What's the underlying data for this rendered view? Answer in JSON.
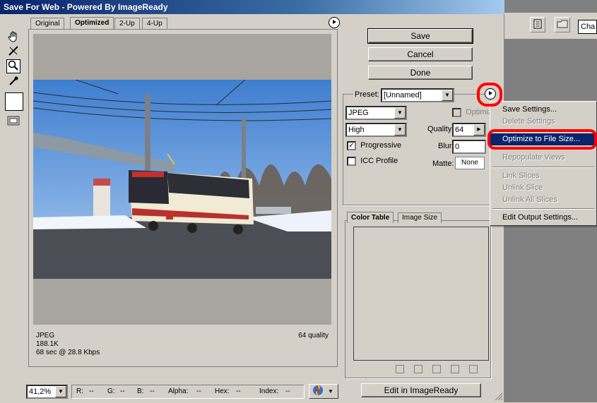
{
  "window": {
    "title": "Save For Web - Powered By ImageReady"
  },
  "app_toolbar": {
    "palette_label": "Cha"
  },
  "tabs": [
    {
      "label": "Original"
    },
    {
      "label": "Optimized"
    },
    {
      "label": "2-Up"
    },
    {
      "label": "4-Up"
    }
  ],
  "preview": {
    "format": "JPEG",
    "size": "188.1K",
    "time": "68 sec @ 28.8 Kbps",
    "quality_note": "64 quality"
  },
  "buttons": {
    "save": "Save",
    "cancel": "Cancel",
    "done": "Done",
    "edit": "Edit in ImageReady"
  },
  "settings": {
    "preset_label": "Preset:",
    "preset_value": "[Unnamed]",
    "format_value": "JPEG",
    "optimized_label": "Optimized",
    "level_value": "High",
    "quality_label": "Quality:",
    "quality_value": "64",
    "progressive_label": "Progressive",
    "progressive_checked": true,
    "blur_label": "Blur:",
    "blur_value": "0",
    "icc_label": "ICC Profile",
    "icc_checked": false,
    "matte_label": "Matte:",
    "matte_value": "None"
  },
  "panel_tabs": {
    "color_table": "Color Table",
    "image_size": "Image Size"
  },
  "menu": {
    "items": [
      {
        "label": "Save Settings...",
        "disabled": false
      },
      {
        "label": "Delete Settings",
        "disabled": true
      },
      {
        "label": "Optimize to File Size...",
        "disabled": false,
        "highlighted": true
      },
      {
        "label": "Repopulate Views",
        "disabled": true
      },
      {
        "label": "Link Slices",
        "disabled": true
      },
      {
        "label": "Unlink Slice",
        "disabled": true
      },
      {
        "label": "Unlink All Slices",
        "disabled": true
      },
      {
        "label": "Edit Output Settings...",
        "disabled": false
      }
    ]
  },
  "status": {
    "zoom": "41,2%",
    "r_label": "R:",
    "r_value": "--",
    "g_label": "G:",
    "g_value": "--",
    "b_label": "B:",
    "b_value": "--",
    "alpha_label": "Alpha:",
    "alpha_value": "--",
    "hex_label": "Hex:",
    "hex_value": "--",
    "index_label": "Index:",
    "index_value": "--"
  },
  "icons": [
    "hand-icon",
    "slice-select-icon",
    "zoom-icon",
    "eyedropper-icon",
    "toggle-slices-icon",
    "browser-preview-icon"
  ]
}
